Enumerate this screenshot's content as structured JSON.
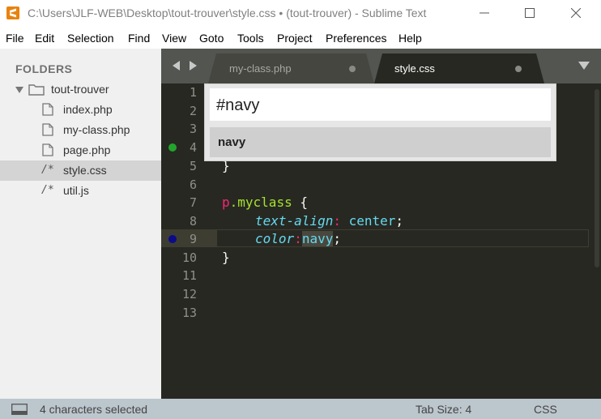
{
  "window": {
    "title": "C:\\Users\\JLF-WEB\\Desktop\\tout-trouver\\style.css • (tout-trouver) - Sublime Text"
  },
  "menu": [
    "File",
    "Edit",
    "Selection",
    "Find",
    "View",
    "Goto",
    "Tools",
    "Project",
    "Preferences",
    "Help"
  ],
  "sidebar": {
    "header": "FOLDERS",
    "folder": "tout-trouver",
    "files": [
      {
        "name": "index.php",
        "icon": "file-icon"
      },
      {
        "name": "my-class.php",
        "icon": "file-icon"
      },
      {
        "name": "page.php",
        "icon": "file-icon"
      },
      {
        "name": "style.css",
        "icon": "/*",
        "selected": true
      },
      {
        "name": "util.js",
        "icon": "/*"
      }
    ]
  },
  "tabs": [
    {
      "label": "my-class.php",
      "active": false,
      "dirty": true
    },
    {
      "label": "style.css",
      "active": true,
      "dirty": true
    }
  ],
  "goto": {
    "query": "#navy",
    "result": "navy"
  },
  "editor": {
    "line_numbers": [
      "1",
      "2",
      "3",
      "4",
      "5",
      "6",
      "7",
      "8",
      "9",
      "10",
      "11",
      "12",
      "13"
    ],
    "gutter_markers": [
      {
        "line": 4,
        "color": "#22a52b"
      },
      {
        "line": 9,
        "color": "#0b0b8a"
      }
    ],
    "code": {
      "l5": "}",
      "l7_sel": "p",
      "l7_cls": ".myclass",
      "l7_brace": " {",
      "l8_prop": "text-align",
      "l8_colon": ": ",
      "l8_val": "center",
      "l8_semi": ";",
      "l9_prop": "color",
      "l9_colon": ":",
      "l9_val": "navy",
      "l9_semi": ";",
      "l10": "}"
    },
    "colors": {
      "background": "#272822",
      "selector": "#f92672",
      "class": "#a6e22e",
      "property": "#66d9ef"
    }
  },
  "status": {
    "selection": "4 characters selected",
    "tab_size": "Tab Size: 4",
    "syntax": "CSS"
  }
}
